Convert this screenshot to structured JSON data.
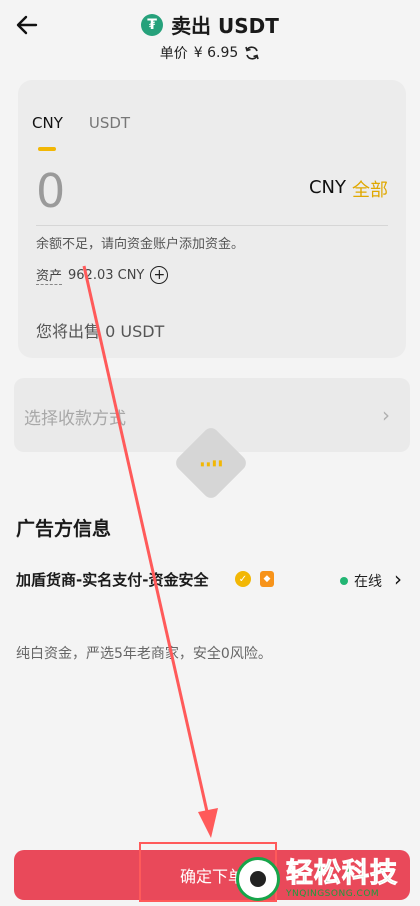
{
  "header": {
    "title": "卖出 USDT",
    "price_label": "单价",
    "price_value": "¥ 6.95",
    "token_symbol": "₮"
  },
  "trade": {
    "tabs": [
      {
        "label": "CNY",
        "active": true
      },
      {
        "label": "USDT",
        "active": false
      }
    ],
    "amount": "0",
    "unit": "CNY",
    "all_label": "全部",
    "warning": "余额不足，请向资金账户添加资金。",
    "asset_label": "资产",
    "asset_value": "962.03 CNY",
    "sell_info": "您将出售 0 USDT"
  },
  "payment": {
    "label": "选择收款方式"
  },
  "advertiser": {
    "section_title": "广告方信息",
    "name": "加盾货商-实名支付-资金安全",
    "status": "在线",
    "description": "纯白资金，严选5年老商家，安全0风险。"
  },
  "footer": {
    "confirm_label": "确定下单"
  },
  "watermark": {
    "brand": "轻松科技",
    "domain": "YNQINGSONG.COM"
  },
  "colors": {
    "accent": "#f2b705",
    "confirm_bg": "#e9495a",
    "online": "#22b573",
    "annotation": "#ff5a5a",
    "tether": "#26a17b"
  }
}
